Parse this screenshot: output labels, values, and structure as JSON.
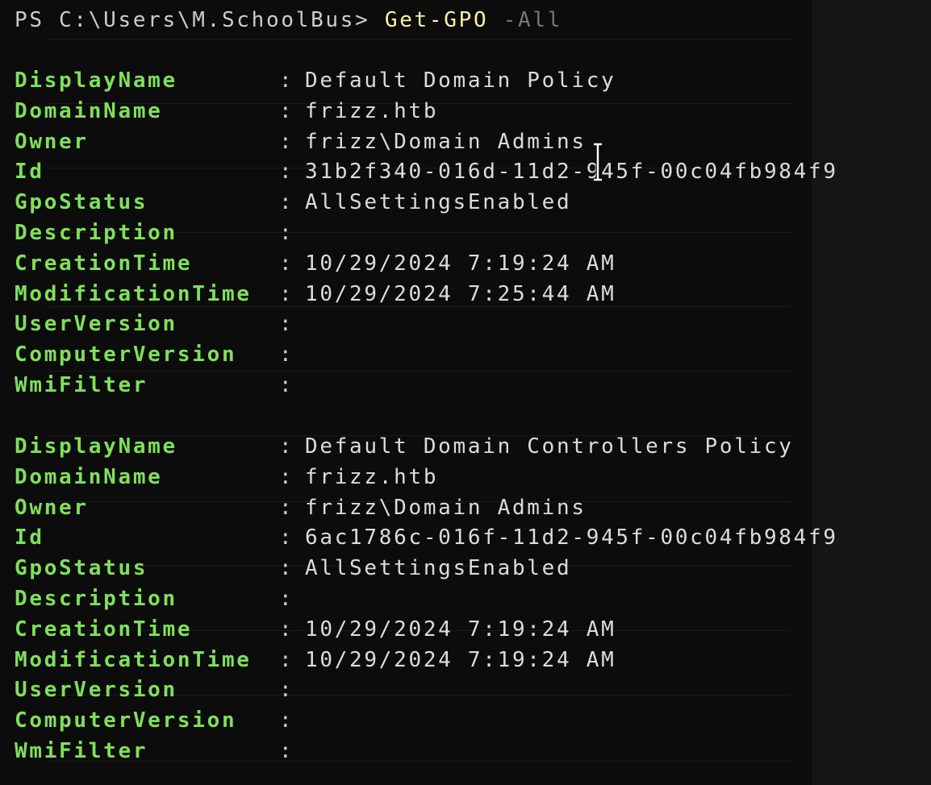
{
  "terminal": {
    "prompt": "PS C:\\Users\\M.SchoolBus>",
    "command": "Get-GPO",
    "parameter": "-All"
  },
  "gpos": [
    {
      "fields": [
        {
          "key": "DisplayName",
          "value": "Default Domain Policy"
        },
        {
          "key": "DomainName",
          "value": "frizz.htb"
        },
        {
          "key": "Owner",
          "value": "frizz\\Domain Admins"
        },
        {
          "key": "Id",
          "value": "31b2f340-016d-11d2-945f-00c04fb984f9"
        },
        {
          "key": "GpoStatus",
          "value": "AllSettingsEnabled"
        },
        {
          "key": "Description",
          "value": ""
        },
        {
          "key": "CreationTime",
          "value": "10/29/2024 7:19:24 AM"
        },
        {
          "key": "ModificationTime",
          "value": "10/29/2024 7:25:44 AM"
        },
        {
          "key": "UserVersion",
          "value": ""
        },
        {
          "key": "ComputerVersion",
          "value": ""
        },
        {
          "key": "WmiFilter",
          "value": ""
        }
      ]
    },
    {
      "fields": [
        {
          "key": "DisplayName",
          "value": "Default Domain Controllers Policy"
        },
        {
          "key": "DomainName",
          "value": "frizz.htb"
        },
        {
          "key": "Owner",
          "value": "frizz\\Domain Admins"
        },
        {
          "key": "Id",
          "value": "6ac1786c-016f-11d2-945f-00c04fb984f9"
        },
        {
          "key": "GpoStatus",
          "value": "AllSettingsEnabled"
        },
        {
          "key": "Description",
          "value": ""
        },
        {
          "key": "CreationTime",
          "value": "10/29/2024 7:19:24 AM"
        },
        {
          "key": "ModificationTime",
          "value": "10/29/2024 7:19:24 AM"
        },
        {
          "key": "UserVersion",
          "value": ""
        },
        {
          "key": "ComputerVersion",
          "value": ""
        },
        {
          "key": "WmiFilter",
          "value": ""
        }
      ]
    }
  ],
  "separator": ":",
  "colors": {
    "background": "#0c0c0c",
    "key": "#7fe05a",
    "value": "#dcdcdc",
    "command": "#f9f1a5",
    "parameter": "#767676"
  },
  "icons": {
    "cursor": "text-cursor-icon"
  }
}
